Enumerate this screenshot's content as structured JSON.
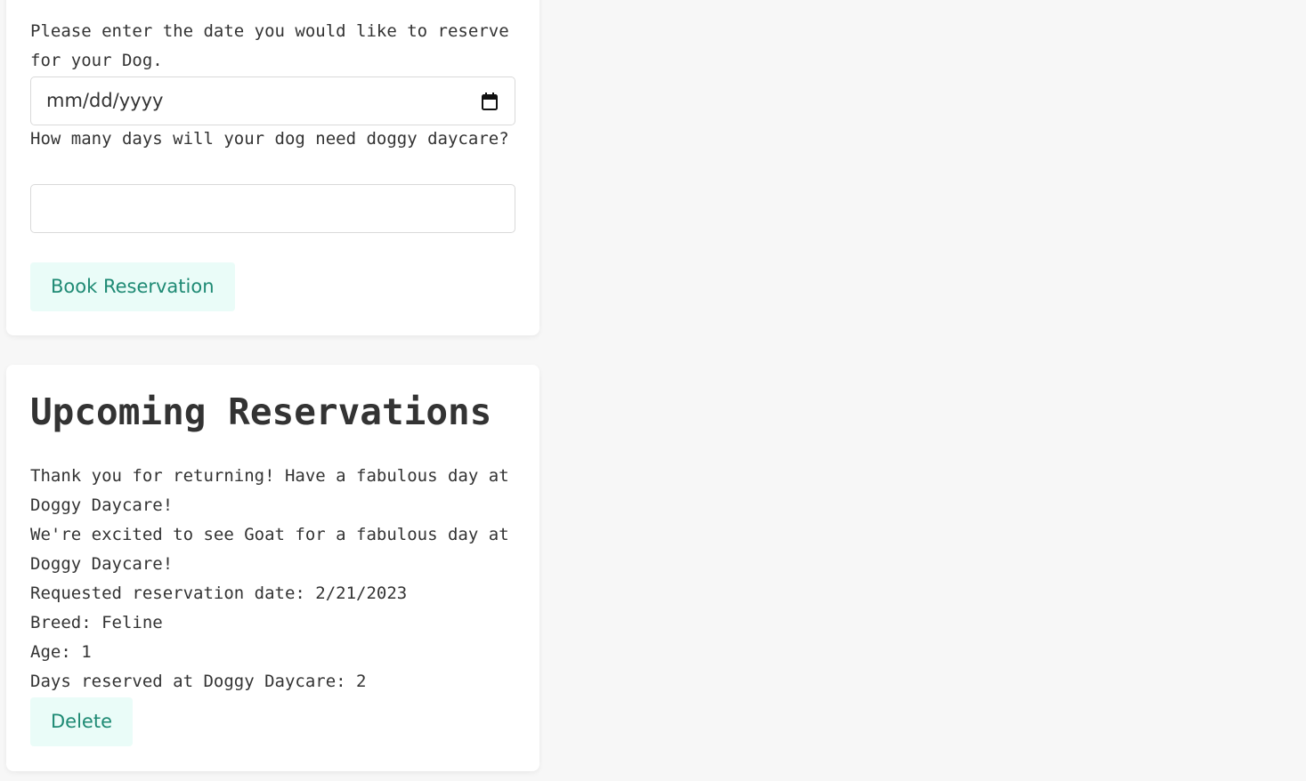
{
  "form": {
    "date_label": "Please enter the date you would like to reserve for your Dog.",
    "date_placeholder": "mm/dd/yyyy",
    "days_label": "How many days will your dog need doggy daycare?",
    "days_value": "",
    "book_button": "Book Reservation"
  },
  "reservations": {
    "title": "Upcoming Reservations",
    "returning_message": "Thank you for returning! Have a fabulous day at Doggy Daycare!",
    "excited_message": "We're excited to see Goat for a fabulous day at Doggy Daycare!",
    "requested_date": "Requested reservation date: 2/21/2023",
    "breed": "Breed: Feline",
    "age": "Age: 1",
    "days_reserved": "Days reserved at Doggy Daycare: 2",
    "delete_button": "Delete"
  },
  "icons": {
    "calendar": "calendar-icon"
  },
  "colors": {
    "button_bg": "#eafcf8",
    "button_text": "#1e8a74",
    "text": "#333333"
  }
}
